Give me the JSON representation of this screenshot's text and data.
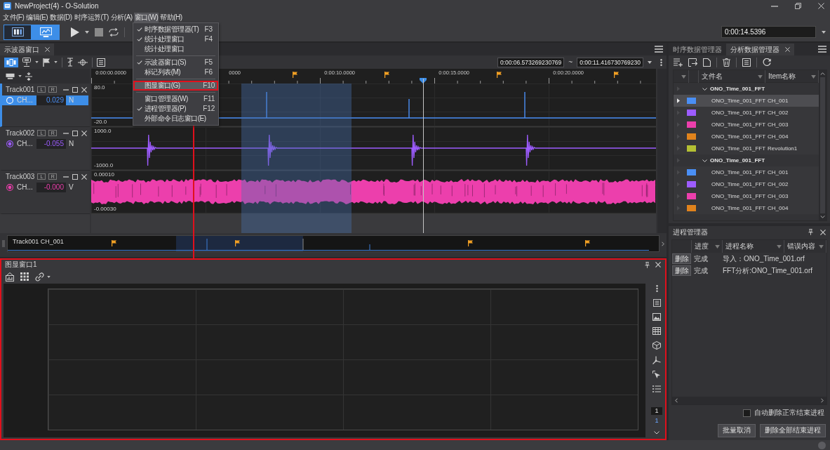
{
  "window": {
    "title": "NewProject(4) - O-Solution"
  },
  "menu_bar": [
    {
      "label": "文件(F)",
      "selected": false
    },
    {
      "label": "编辑(E)",
      "selected": false
    },
    {
      "label": "数据(D)",
      "selected": false
    },
    {
      "label": "时序运算(T)",
      "selected": false
    },
    {
      "label": "分析(A)",
      "selected": false
    },
    {
      "label": "窗口(W)",
      "selected": true,
      "menu": [
        {
          "kind": "item",
          "label": "时序数据管理器(T)",
          "shortcut": "F3",
          "checked": true,
          "highlighted": false,
          "callout": false
        },
        {
          "kind": "item",
          "label": "统计处理窗口",
          "shortcut": "F4",
          "checked": true,
          "highlighted": false,
          "callout": false
        },
        {
          "kind": "item",
          "label": "统计处理窗口",
          "checked": false,
          "highlighted": false,
          "callout": false
        },
        {
          "kind": "separator"
        },
        {
          "kind": "item",
          "label": "示波器窗口(S)",
          "shortcut": "F5",
          "checked": true,
          "highlighted": false,
          "callout": false
        },
        {
          "kind": "item",
          "label": "标记列表(M)",
          "shortcut": "F6",
          "checked": false,
          "highlighted": false,
          "callout": false
        },
        {
          "kind": "separator"
        },
        {
          "kind": "item",
          "label": "图显窗口(G)",
          "shortcut": "F10",
          "checked": false,
          "highlighted": true,
          "callout": true
        },
        {
          "kind": "separator"
        },
        {
          "kind": "item",
          "label": "窗口管理器(W)",
          "shortcut": "F11",
          "checked": false,
          "highlighted": false,
          "callout": false
        },
        {
          "kind": "item",
          "label": "进程管理器(P)",
          "shortcut": "F12",
          "checked": true,
          "highlighted": false,
          "callout": false
        },
        {
          "kind": "item",
          "label": "外部命令日志窗口(E)",
          "checked": false,
          "highlighted": false,
          "callout": false
        }
      ]
    },
    {
      "label": "帮助(H)",
      "selected": false
    }
  ],
  "toolbar": {
    "view_buttons": [
      {
        "selected": false
      },
      {
        "selected": true
      }
    ],
    "time": "0:00:14.5396"
  },
  "scope_window": {
    "tab": "示波器窗口",
    "track_view_button": {
      "selected": true
    },
    "range_start": "0:00:06.573269230769",
    "range_separator": "~",
    "range_end": "0:00:11.416730769230",
    "ruler_labels": [
      "0:00:00.0000",
      "0000",
      "0:00:10.0000",
      "0:00:15.0000",
      "0:00:20.0000"
    ],
    "tracks": [
      {
        "name": "Track001",
        "buttons": [
          "L",
          "R"
        ],
        "channel": "CH...",
        "value": "0.029",
        "unit": "N",
        "color": "#4a8ff5",
        "selected": true,
        "y_max": "80.0",
        "y_min": "-20.0",
        "kind": "spikes"
      },
      {
        "name": "Track002",
        "buttons": [
          "L",
          "R"
        ],
        "channel": "CH...",
        "value": "-0.055",
        "unit": "N",
        "color": "#9d5cff",
        "selected": false,
        "y_max": "1000.0",
        "y_min": "-1000.0",
        "kind": "bursts"
      },
      {
        "name": "Track003",
        "buttons": [
          "L",
          "R"
        ],
        "channel": "CH...",
        "value": "-0.000",
        "unit": "V",
        "color": "#ec3fac",
        "selected": false,
        "y_max": "0.00010",
        "y_min": "-0.00030",
        "kind": "noise"
      }
    ],
    "overview_label": "Track001 CH_001"
  },
  "graph_window": {
    "title": "图显窗口1",
    "callout": true,
    "page": "1",
    "page_total": "1"
  },
  "data_manager": {
    "tabs": [
      {
        "label": "时序数据管理器",
        "selected": false
      },
      {
        "label": "分析数据管理器",
        "selected": true
      }
    ],
    "columns": [
      "文件名",
      "Item名称"
    ],
    "groups": [
      {
        "label": "ONO_Time_001_FFT",
        "expanded": true,
        "children": [
          {
            "file": "ONO_Time_001_FFT",
            "item": "CH_001",
            "color": "#4a8ff5",
            "selected": true
          },
          {
            "file": "ONO_Time_001_FFT",
            "item": "CH_002",
            "color": "#9d5cff",
            "selected": false
          },
          {
            "file": "ONO_Time_001_FFT",
            "item": "CH_003",
            "color": "#ec3fac",
            "selected": false
          },
          {
            "file": "ONO_Time_001_FFT",
            "item": "CH_004",
            "color": "#e0831c",
            "selected": false
          },
          {
            "file": "ONO_Time_001_FFT",
            "item": "Revolution1",
            "color": "#b4c033",
            "selected": false
          }
        ]
      },
      {
        "label": "ONO_Time_001_FFT",
        "expanded": true,
        "children": [
          {
            "file": "ONO_Time_001_FFT",
            "item": "CH_001",
            "color": "#4a8ff5",
            "selected": false
          },
          {
            "file": "ONO_Time_001_FFT",
            "item": "CH_002",
            "color": "#9d5cff",
            "selected": false
          },
          {
            "file": "ONO_Time_001_FFT",
            "item": "CH_003",
            "color": "#ec3fac",
            "selected": false
          },
          {
            "file": "ONO_Time_001_FFT",
            "item": "CH_004",
            "color": "#e0831c",
            "selected": false
          }
        ]
      }
    ]
  },
  "process_manager": {
    "title": "进程管理器",
    "columns": [
      "进度",
      "进程名称",
      "错误内容"
    ],
    "rows": [
      {
        "action": "删除",
        "progress": "完成",
        "name": "导入：ONO_Time_001.orf"
      },
      {
        "action": "删除",
        "progress": "完成",
        "name": "FFT分析:ONO_Time_001.orf"
      }
    ],
    "auto_delete": {
      "label": "自动删除正常结束进程",
      "checked": false
    },
    "buttons": [
      "批量取消",
      "删除全部结束进程"
    ]
  }
}
